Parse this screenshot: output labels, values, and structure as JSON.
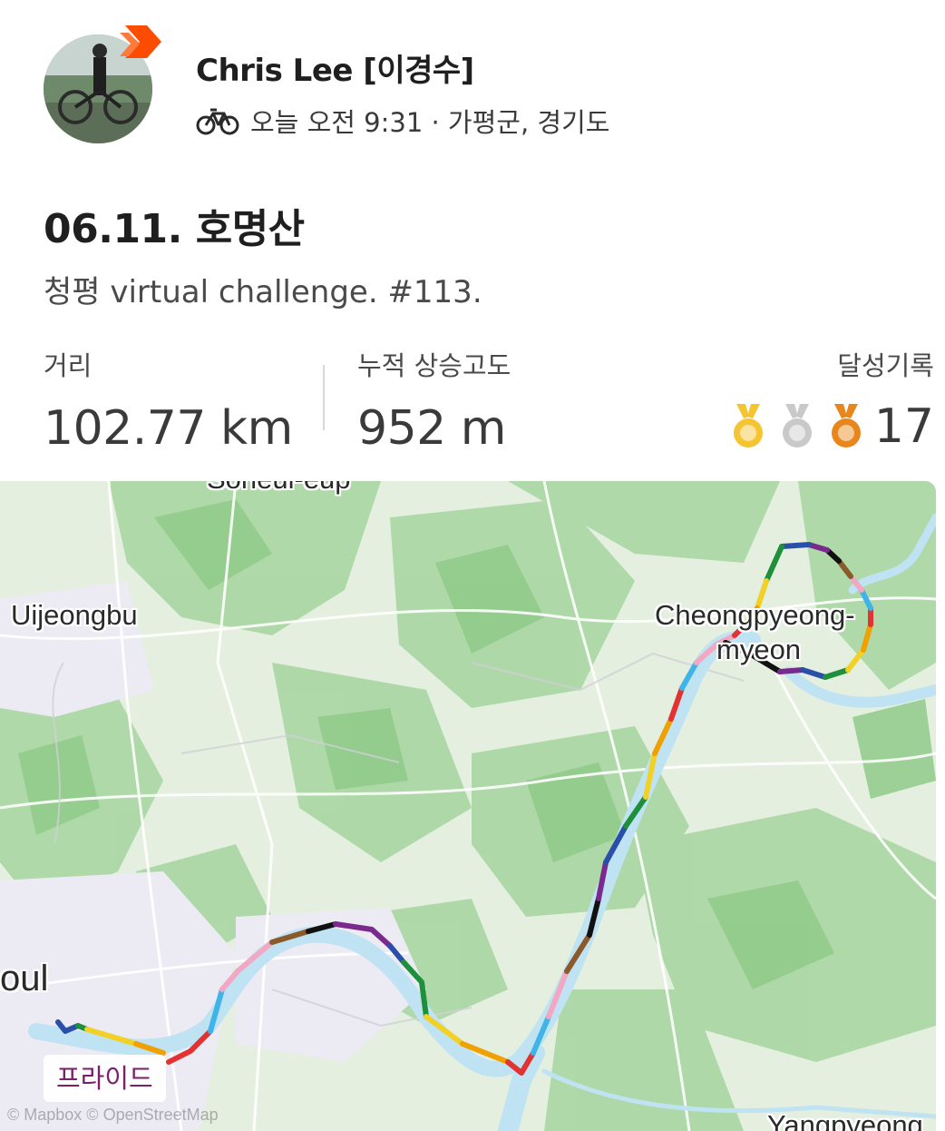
{
  "athlete": {
    "name": "Chris Lee [이경수]",
    "time_location": "오늘 오전 9:31 · 가평군, 경기도"
  },
  "activity": {
    "title": "06.11. 호명산",
    "description": "청평 virtual challenge. #113."
  },
  "stats": {
    "distance_label": "거리",
    "distance_value": "102.77 km",
    "elevation_label": "누적 상승고도",
    "elevation_value": "952 m",
    "achievements_label": "달성기록",
    "achievements_count": "17"
  },
  "map": {
    "labels": {
      "uijeongbu": "Uijeongbu",
      "top_cut": "Sorieul-eup",
      "cheongpyeong_1": "Cheongpyeong-",
      "cheongpyeong_2": "myeon",
      "seoul_fragment": "oul",
      "yangpyeong": "Yangpyeong"
    },
    "tag": "프라이드",
    "attribution": "© Mapbox © OpenStreetMap"
  },
  "colors": {
    "medal_gold": "#f5c431",
    "medal_silver": "#c9c9c9",
    "medal_bronze": "#e8861c",
    "strava_orange": "#fc4c02",
    "river": "#bfe3f2",
    "forest": "#9fd19a"
  },
  "icons": {
    "ride": "bike-icon",
    "badge": "strava-chevron-icon"
  }
}
